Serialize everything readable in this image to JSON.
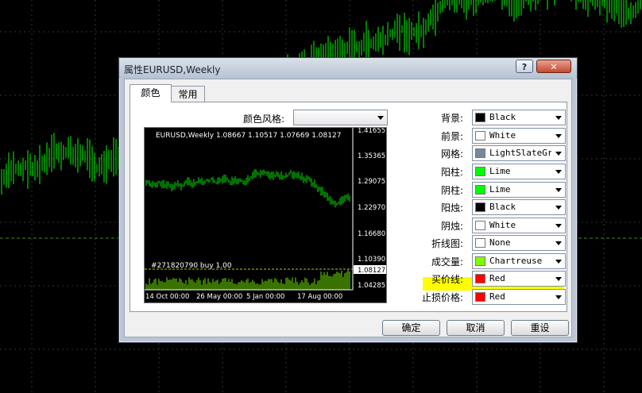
{
  "dialog": {
    "title": "属性EURUSD,Weekly",
    "help_label": "?",
    "close_label": "✕"
  },
  "tabs": [
    {
      "label": "颜色",
      "active": true
    },
    {
      "label": "常用",
      "active": false
    }
  ],
  "color_scheme": {
    "label": "颜色风格:",
    "value": ""
  },
  "preview": {
    "header": "EURUSD,Weekly  1.08667 1.10517 1.07669 1.08127",
    "order_label": "#271820790 buy 1.00",
    "price_ticks": [
      "1.41655",
      "1.35365",
      "1.29075",
      "1.22970",
      "1.16680",
      "1.10390",
      "1.04285"
    ],
    "current_price": "1.08127",
    "date_ticks": [
      "14 Oct 00:00",
      "26 May 00:00",
      "5 Jan 00:00",
      "17 Aug 00:00"
    ]
  },
  "properties": [
    {
      "label": "背景:",
      "value": "Black",
      "color": "#000000"
    },
    {
      "label": "前景:",
      "value": "White",
      "color": "#ffffff"
    },
    {
      "label": "网格:",
      "value": "LightSlateGr",
      "color": "#778899"
    },
    {
      "label": "阳柱:",
      "value": "Lime",
      "color": "#00ff00"
    },
    {
      "label": "阴柱:",
      "value": "Lime",
      "color": "#00ff00"
    },
    {
      "label": "阳烛:",
      "value": "Black",
      "color": "#000000"
    },
    {
      "label": "阴烛:",
      "value": "White",
      "color": "#ffffff"
    },
    {
      "label": "折线图:",
      "value": "None",
      "color": "#ffffff"
    },
    {
      "label": "成交量:",
      "value": "Chartreuse",
      "color": "#7fff00",
      "highlighted": true
    },
    {
      "label": "买价线:",
      "value": "Red",
      "color": "#ff0000"
    },
    {
      "label": "止损价格:",
      "value": "Red",
      "color": "#ff0000"
    }
  ],
  "buttons": {
    "ok": "确定",
    "cancel": "取消",
    "reset": "重设"
  },
  "colors": {
    "bar_green": "#00ff00",
    "volume": "#7fff00",
    "highlight": "#ffff00",
    "ask_line": "#ff0000"
  }
}
